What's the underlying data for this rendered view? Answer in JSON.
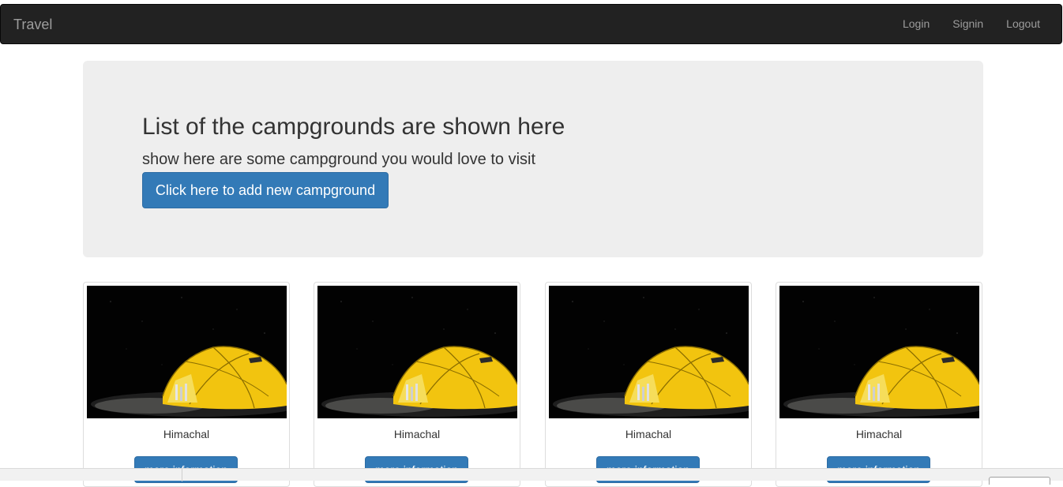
{
  "navbar": {
    "brand": "Travel",
    "links": [
      "Login",
      "Signin",
      "Logout"
    ]
  },
  "jumbotron": {
    "title": "List of the campgrounds are shown here",
    "subtitle": "show here are some campground you would love to visit",
    "add_button": "Click here to add new campground"
  },
  "campgrounds": [
    {
      "name": "Himachal",
      "button": "more information",
      "image": "yellow-tent-at-night"
    },
    {
      "name": "Himachal",
      "button": "more information",
      "image": "yellow-tent-at-night"
    },
    {
      "name": "Himachal",
      "button": "more information",
      "image": "yellow-tent-at-night"
    },
    {
      "name": "Himachal",
      "button": "more information",
      "image": "yellow-tent-at-night"
    }
  ],
  "colors": {
    "navbar_bg": "#222222",
    "jumbotron_bg": "#eeeeee",
    "primary": "#337ab7",
    "tent": "#f2c40f"
  }
}
